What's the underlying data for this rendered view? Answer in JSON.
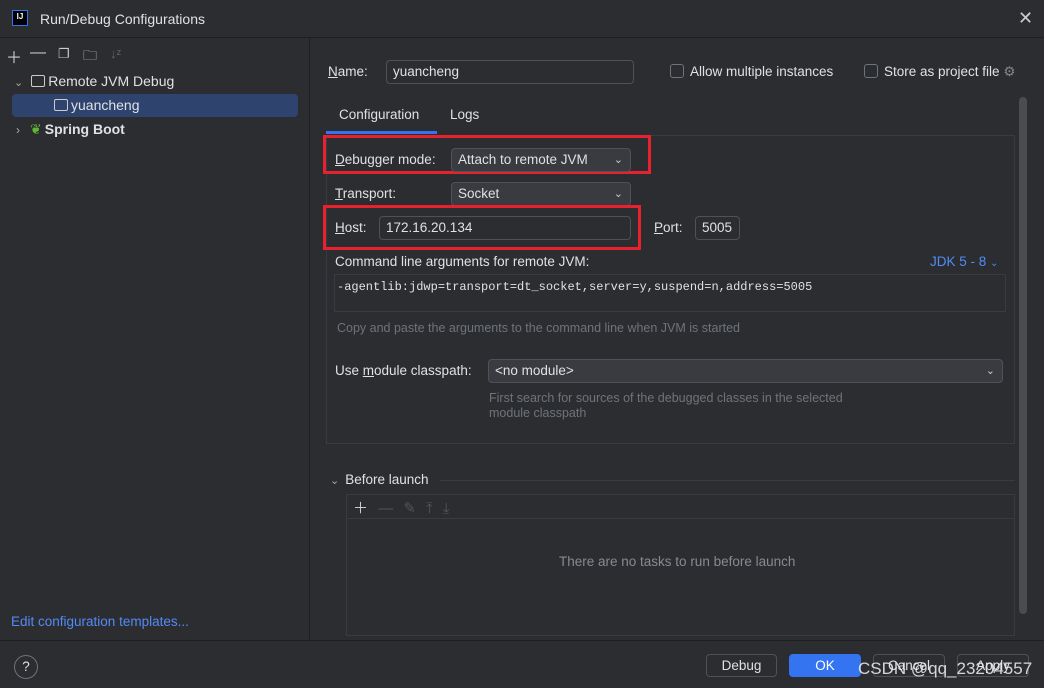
{
  "window": {
    "title": "Run/Debug Configurations",
    "logo": "IJ"
  },
  "sidebar": {
    "toolbar": [
      "plus-icon",
      "minus-icon",
      "copy-icon",
      "new-folder-icon",
      "sort-icon"
    ],
    "tree": [
      {
        "label": "Remote JVM Debug",
        "expanded": true
      },
      {
        "label": "yuancheng",
        "selected": true
      },
      {
        "label": "Spring Boot",
        "expanded": false
      }
    ],
    "templates_link": "Edit configuration templates..."
  },
  "form": {
    "name_label": "Name:",
    "name_value": "yuancheng",
    "allow_multiple": "Allow multiple instances",
    "store_project": "Store as project file",
    "tabs": [
      {
        "label": "Configuration",
        "active": true
      },
      {
        "label": "Logs"
      }
    ],
    "debugger_mode_label": "Debugger mode:",
    "debugger_mode_value": "Attach to remote JVM",
    "transport_label": "Transport:",
    "transport_value": "Socket",
    "host_label": "Host:",
    "host_value": "172.16.20.134",
    "port_label": "Port:",
    "port_value": "5005",
    "cmd_label": "Command line arguments for remote JVM:",
    "jdk_value": "JDK 5 - 8",
    "cmd_value": "-agentlib:jdwp=transport=dt_socket,server=y,suspend=n,address=5005",
    "cmd_hint": "Copy and paste the arguments to the command line when JVM is started",
    "module_label": "Use module classpath:",
    "module_value": "<no module>",
    "module_hint_1": "First search for sources of the debugged classes in the selected",
    "module_hint_2": "module classpath",
    "before_launch": "Before launch",
    "no_tasks": "There are no tasks to run before launch"
  },
  "footer": {
    "help": "?",
    "debug": "Debug",
    "ok": "OK",
    "cancel": "Cancel",
    "apply": "Apply",
    "watermark": "CSDN @qq_23204557"
  },
  "colors": {
    "accent": "#3574f0",
    "highlight": "#e8212f",
    "selection": "#2e436e"
  }
}
